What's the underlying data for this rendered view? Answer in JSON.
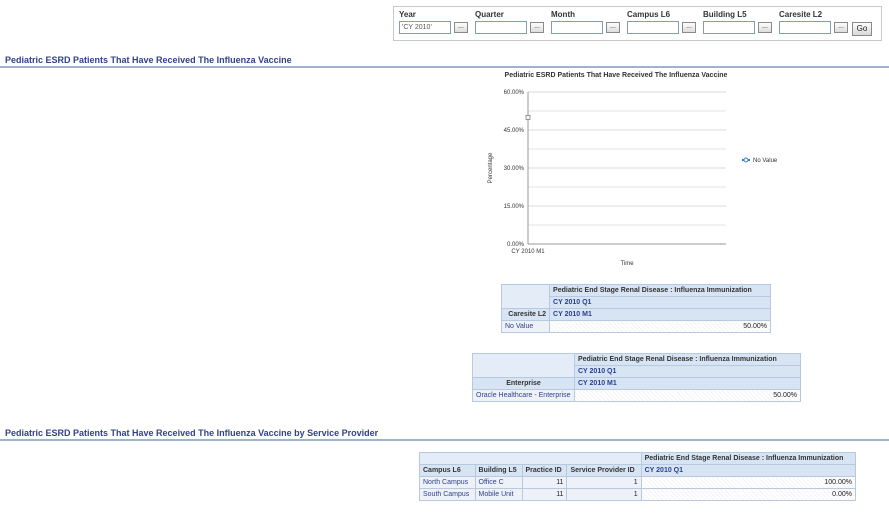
{
  "prompts": {
    "items": [
      {
        "label": "Year",
        "value": "'CY 2010'"
      },
      {
        "label": "Quarter",
        "value": ""
      },
      {
        "label": "Month",
        "value": ""
      },
      {
        "label": "Campus L6",
        "value": ""
      },
      {
        "label": "Building L5",
        "value": ""
      },
      {
        "label": "Caresite L2",
        "value": ""
      }
    ],
    "browse_label": "...",
    "go_label": "Go"
  },
  "section1": {
    "title": "Pediatric ESRD Patients That Have Received The Influenza Vaccine"
  },
  "section2": {
    "title": "Pediatric ESRD Patients That Have Received The Influenza Vaccine by Service Provider"
  },
  "chart_data": {
    "type": "line",
    "title": "Pediatric ESRD Patients That Have Received The Influenza Vaccine",
    "xlabel": "Time",
    "ylabel": "Percentage",
    "categories": [
      "CY 2010 M1"
    ],
    "series": [
      {
        "name": "No Value",
        "values": [
          50
        ]
      }
    ],
    "ylim": [
      0,
      60
    ],
    "yticks": [
      "0.00%",
      "15.00%",
      "30.00%",
      "45.00%",
      "60.00%"
    ],
    "grid": true,
    "legend": "right",
    "series_color": "#3a7fc4"
  },
  "table1": {
    "measure": "Pediatric End Stage Renal Disease : Influenza Immunization",
    "quarter": "CY 2010 Q1",
    "row_header": "Caresite L2",
    "month": "CY 2010 M1",
    "rows": [
      {
        "label": "No Value",
        "value": "50.00%"
      }
    ]
  },
  "table2": {
    "measure": "Pediatric End Stage Renal Disease : Influenza Immunization",
    "quarter": "CY 2010 Q1",
    "row_header": "Enterprise",
    "month": "CY 2010 M1",
    "rows": [
      {
        "label": "Oracle Healthcare - Enterprise",
        "value": "50.00%"
      }
    ]
  },
  "table3": {
    "measure": "Pediatric End Stage Renal Disease : Influenza Immunization",
    "quarter": "CY 2010 Q1",
    "columns": [
      "Campus L6",
      "Building L5",
      "Practice ID",
      "Service Provider ID"
    ],
    "rows": [
      {
        "campus": "North Campus",
        "building": "Office C",
        "practice": "11",
        "provider": "1",
        "value": "100.00%"
      },
      {
        "campus": "South Campus",
        "building": "Mobile Unit",
        "practice": "11",
        "provider": "1",
        "value": "0.00%"
      }
    ]
  }
}
